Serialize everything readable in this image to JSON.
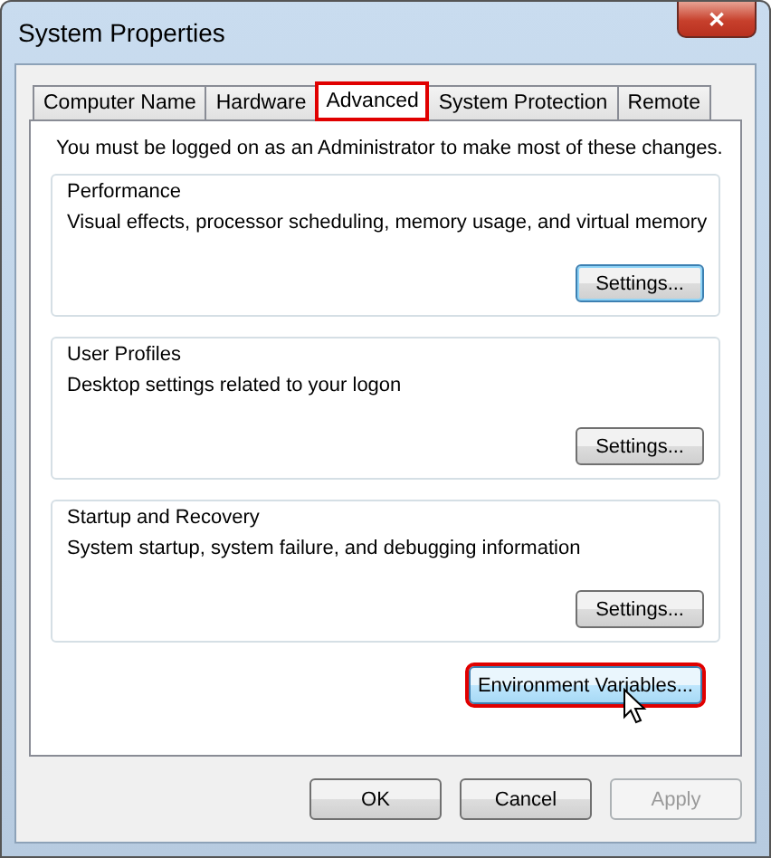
{
  "window": {
    "title": "System Properties",
    "close": "✕"
  },
  "tabs": [
    {
      "label": "Computer Name",
      "selected": false,
      "highlighted": false
    },
    {
      "label": "Hardware",
      "selected": false,
      "highlighted": false
    },
    {
      "label": "Advanced",
      "selected": true,
      "highlighted": true
    },
    {
      "label": "System Protection",
      "selected": false,
      "highlighted": false
    },
    {
      "label": "Remote",
      "selected": false,
      "highlighted": false
    }
  ],
  "notice": "You must be logged on as an Administrator to make most of these changes.",
  "groups": [
    {
      "title": "Performance",
      "description": "Visual effects, processor scheduling, memory usage, and virtual memory",
      "button": "Settings...",
      "focused": true
    },
    {
      "title": "User Profiles",
      "description": "Desktop settings related to your logon",
      "button": "Settings...",
      "focused": false
    },
    {
      "title": "Startup and Recovery",
      "description": "System startup, system failure, and debugging information",
      "button": "Settings...",
      "focused": false
    }
  ],
  "environment_button": {
    "label": "Environment Variables...",
    "highlighted": true,
    "hovered": true
  },
  "buttons": [
    {
      "label": "OK",
      "disabled": false
    },
    {
      "label": "Cancel",
      "disabled": false
    },
    {
      "label": "Apply",
      "disabled": true
    }
  ]
}
